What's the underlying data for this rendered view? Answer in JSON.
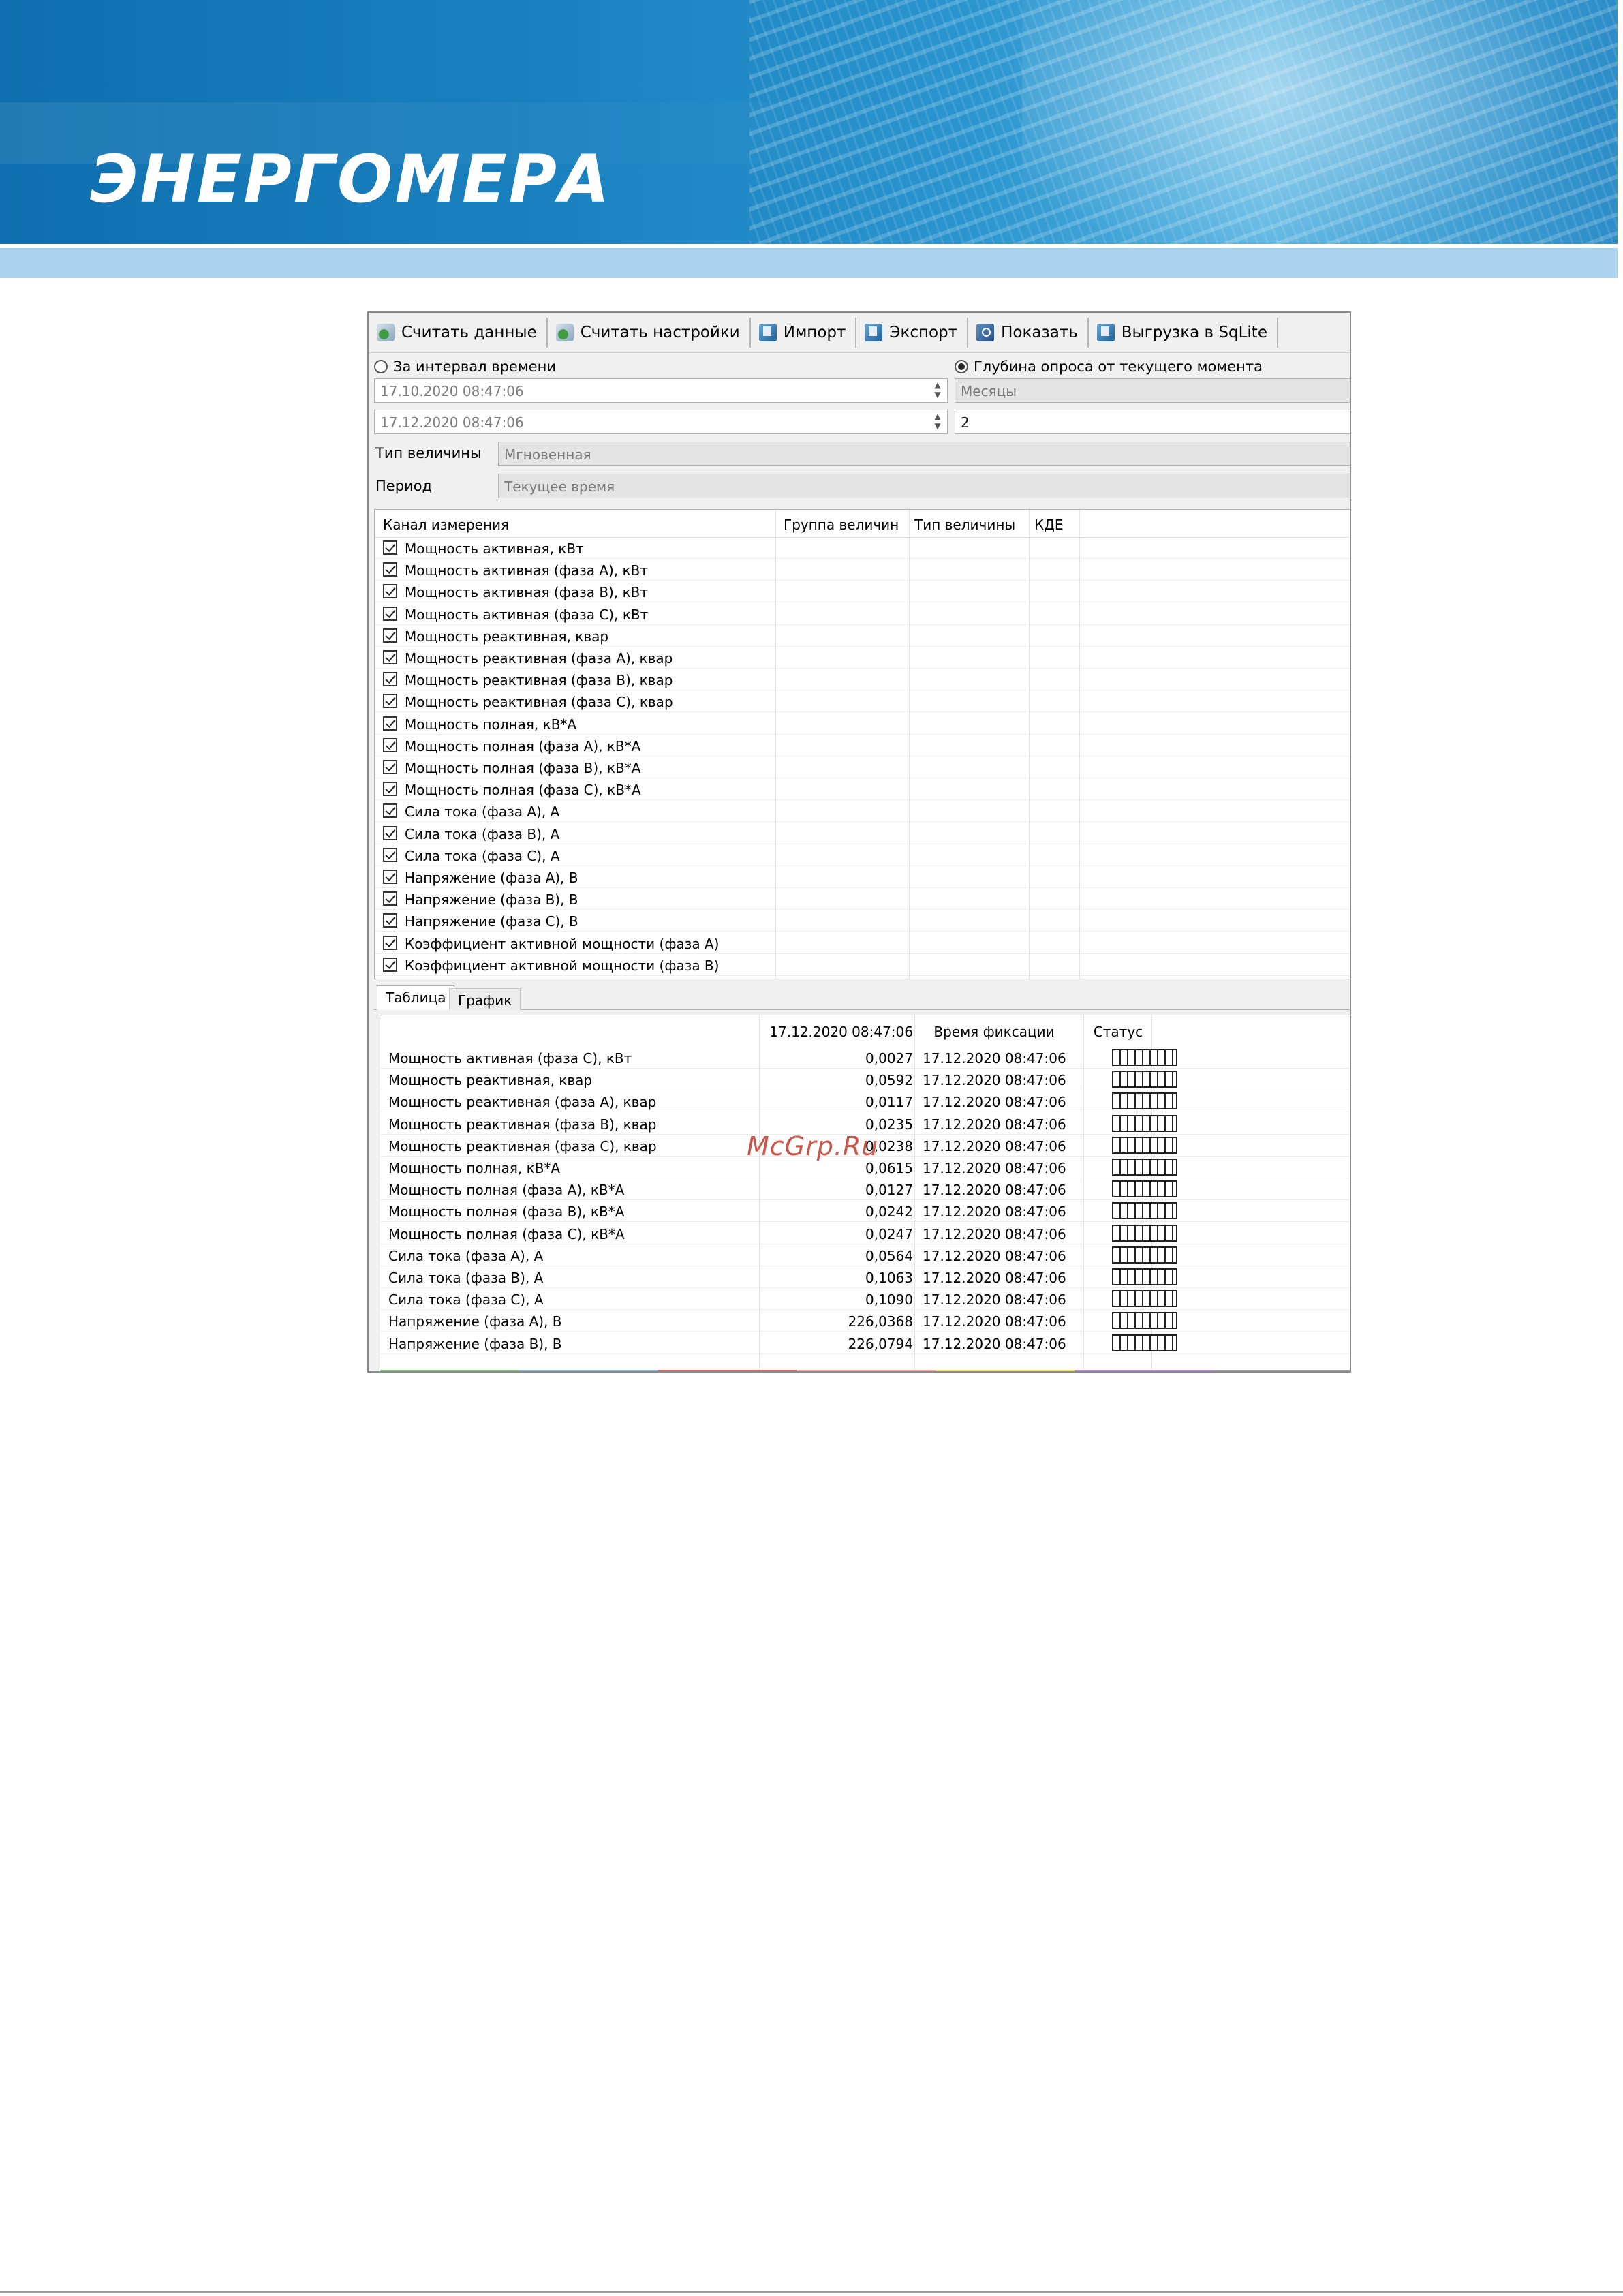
{
  "brand": {
    "logo_text": "ЭНЕРГОМЕРА"
  },
  "toolbar": {
    "buttons": [
      {
        "label": "Считать данные",
        "icon": "read-data-icon"
      },
      {
        "label": "Считать настройки",
        "icon": "read-settings-icon"
      },
      {
        "label": "Импорт",
        "icon": "import-icon"
      },
      {
        "label": "Экспорт",
        "icon": "export-icon"
      },
      {
        "label": "Показать",
        "icon": "show-icon"
      },
      {
        "label": "Выгрузка в SqLite",
        "icon": "sqlite-export-icon"
      }
    ]
  },
  "mode": {
    "interval_label": "За интервал времени",
    "interval_selected": false,
    "depth_label": "Глубина опроса от текущего момента",
    "depth_selected": true
  },
  "interval": {
    "from": "17.10.2020 08:47:06",
    "to": "17.12.2020 08:47:06"
  },
  "depth": {
    "unit": "Месяцы",
    "value": "2"
  },
  "value_type": {
    "label": "Тип величины",
    "value": "Мгновенная"
  },
  "period": {
    "label": "Период",
    "value": "Текущее время"
  },
  "channels": {
    "headers": [
      "Канал измерения",
      "Группа величин",
      "Тип величины",
      "КДЕ"
    ],
    "items": [
      "Мощность активная, кВт",
      "Мощность активная (фаза A), кВт",
      "Мощность активная (фаза B), кВт",
      "Мощность активная (фаза C), кВт",
      "Мощность реактивная, квар",
      "Мощность реактивная (фаза A), квар",
      "Мощность реактивная (фаза B), квар",
      "Мощность реактивная (фаза C), квар",
      "Мощность полная, кВ*А",
      "Мощность полная (фаза A), кВ*А",
      "Мощность полная (фаза B), кВ*А",
      "Мощность полная (фаза C), кВ*А",
      "Сила тока (фаза A), А",
      "Сила тока (фаза B), А",
      "Сила тока (фаза C), А",
      "Напряжение (фаза A), В",
      "Напряжение (фаза B), В",
      "Напряжение (фаза C), В",
      "Коэффициент активной мощности  (фаза A)",
      "Коэффициент активной мощности (фаза B)"
    ]
  },
  "tabs": {
    "table": "Таблица",
    "chart": "График"
  },
  "results": {
    "headers": [
      "17.12.2020 08:47:06",
      "Время фиксации",
      "Статус"
    ],
    "rows": [
      {
        "name": "Мощность активная (фаза C), кВт",
        "value": "0,0027",
        "time": "17.12.2020 08:47:06"
      },
      {
        "name": "Мощность реактивная, квар",
        "value": "0,0592",
        "time": "17.12.2020 08:47:06"
      },
      {
        "name": "Мощность реактивная (фаза A), квар",
        "value": "0,0117",
        "time": "17.12.2020 08:47:06"
      },
      {
        "name": "Мощность реактивная (фаза B), квар",
        "value": "0,0235",
        "time": "17.12.2020 08:47:06"
      },
      {
        "name": "Мощность реактивная (фаза C), квар",
        "value": "0,0238",
        "time": "17.12.2020 08:47:06"
      },
      {
        "name": "Мощность полная, кВ*А",
        "value": "0,0615",
        "time": "17.12.2020 08:47:06"
      },
      {
        "name": "Мощность полная (фаза A), кВ*А",
        "value": "0,0127",
        "time": "17.12.2020 08:47:06"
      },
      {
        "name": "Мощность полная (фаза B), кВ*А",
        "value": "0,0242",
        "time": "17.12.2020 08:47:06"
      },
      {
        "name": "Мощность полная (фаза C), кВ*А",
        "value": "0,0247",
        "time": "17.12.2020 08:47:06"
      },
      {
        "name": "Сила тока (фаза A), А",
        "value": "0,0564",
        "time": "17.12.2020 08:47:06"
      },
      {
        "name": "Сила тока (фаза B), А",
        "value": "0,1063",
        "time": "17.12.2020 08:47:06"
      },
      {
        "name": "Сила тока (фаза C), А",
        "value": "0,1090",
        "time": "17.12.2020 08:47:06"
      },
      {
        "name": "Напряжение (фаза A), В",
        "value": "226,0368",
        "time": "17.12.2020 08:47:06"
      },
      {
        "name": "Напряжение (фаза B), В",
        "value": "226,0794",
        "time": "17.12.2020 08:47:06"
      }
    ]
  },
  "colors": {
    "banner": "#1a82c0",
    "stripe": "#a9d3ee",
    "series_bar": [
      "#7cc47c",
      "#8fb6dd",
      "#e06666",
      "#f4a3a3",
      "#f2e35c",
      "#b58fd6",
      "#9e9e9e"
    ]
  },
  "watermark": "McGrp.Ru"
}
